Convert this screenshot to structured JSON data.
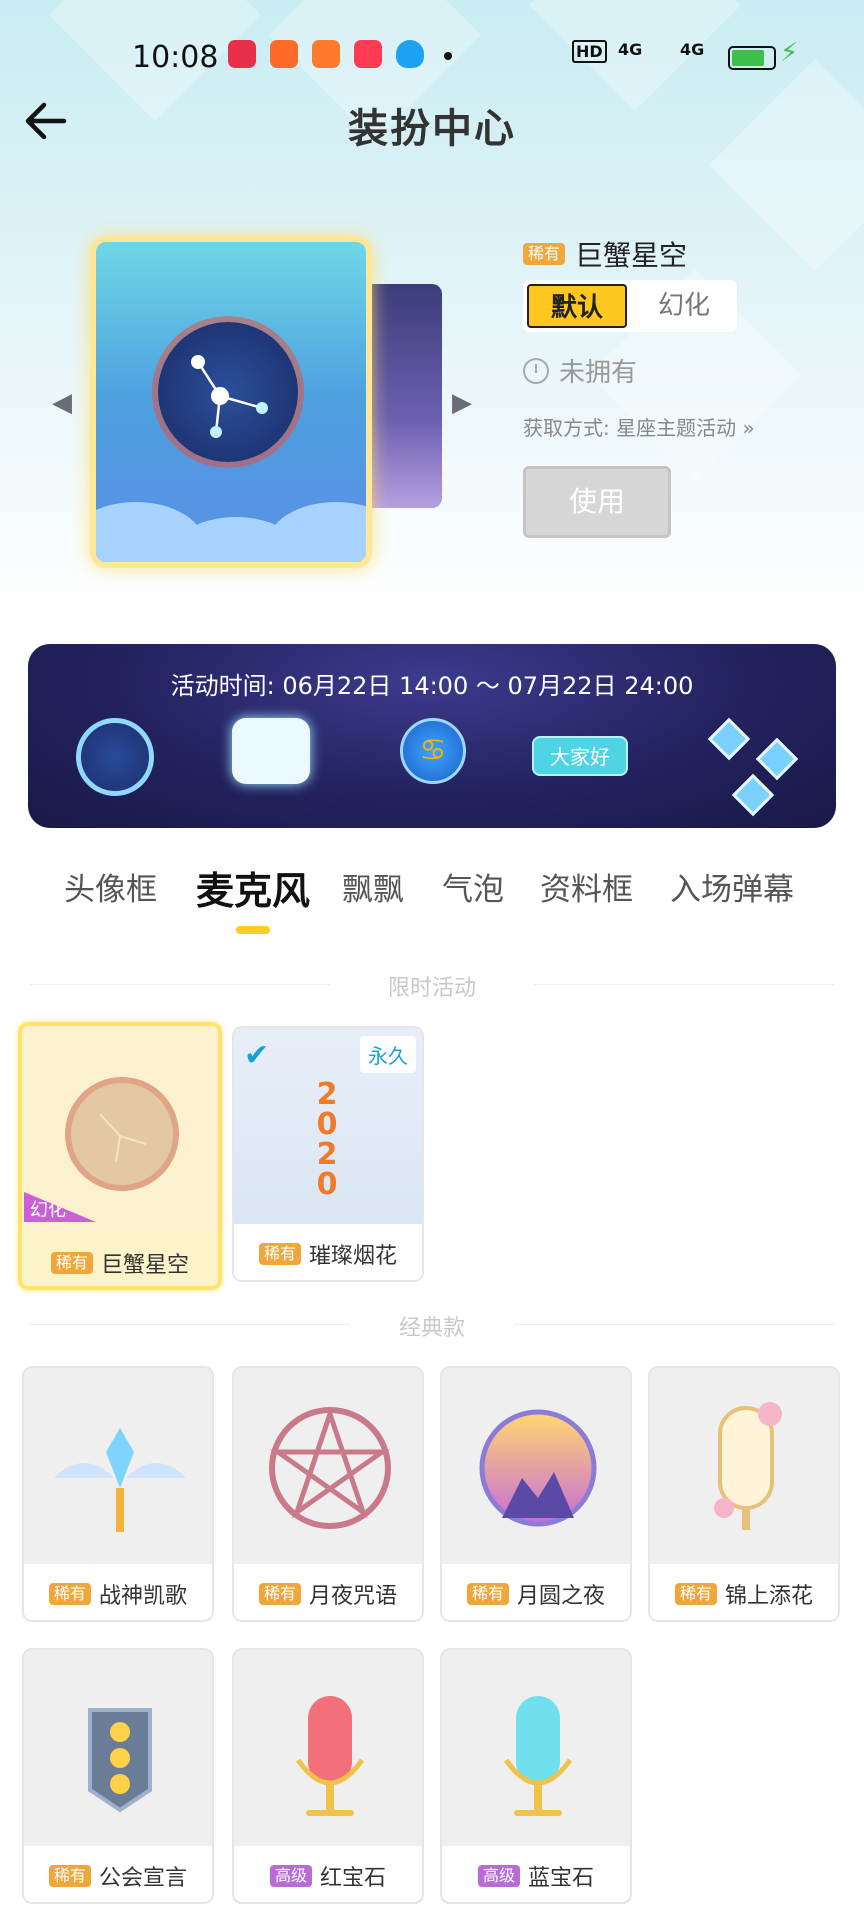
{
  "status_bar": {
    "time": "10:08",
    "signal_1": "4G",
    "signal_2": "4G",
    "hd_label": "HD"
  },
  "header": {
    "title": "装扮中心"
  },
  "preview": {
    "rarity": "稀有",
    "name": "巨蟹星空",
    "toggle": {
      "default_label": "默认",
      "illusion_label": "幻化"
    },
    "ownership": "未拥有",
    "acquire_text": "获取方式: 星座主题活动 »",
    "use_button": "使用"
  },
  "banner": {
    "time_text": "活动时间: 06月22日 14:00 ～ 07月22日 24:00",
    "bubble_text": "大家好"
  },
  "tabs": [
    {
      "label": "头像框",
      "active": false
    },
    {
      "label": "麦克风",
      "active": true
    },
    {
      "label": "飘飘",
      "active": false
    },
    {
      "label": "气泡",
      "active": false
    },
    {
      "label": "资料框",
      "active": false
    },
    {
      "label": "入场弹幕",
      "active": false
    }
  ],
  "sections": {
    "limited": {
      "title": "限时活动",
      "items": [
        {
          "rarity": "稀有",
          "name": "巨蟹星空",
          "tag": "幻化",
          "selected": true
        },
        {
          "rarity": "稀有",
          "name": "璀璨烟花",
          "tag": "永久",
          "owned": true,
          "art_text": "2020"
        }
      ]
    },
    "classic": {
      "title": "经典款",
      "items": [
        {
          "rarity": "稀有",
          "name": "战神凯歌"
        },
        {
          "rarity": "稀有",
          "name": "月夜咒语"
        },
        {
          "rarity": "稀有",
          "name": "月圆之夜"
        },
        {
          "rarity": "稀有",
          "name": "锦上添花"
        },
        {
          "rarity": "稀有",
          "name": "公会宣言"
        },
        {
          "rarity": "高级",
          "name": "红宝石"
        },
        {
          "rarity": "高级",
          "name": "蓝宝石"
        }
      ]
    }
  },
  "colors": {
    "accent_yellow": "#ffc81f",
    "rare_badge": "#f0a63a",
    "advanced_badge": "#b86bd6",
    "illusion_tag": "#c95fd9",
    "banner_bg": "#23225f"
  },
  "icons": [
    "back-arrow-icon",
    "clock-icon",
    "chevron-left-icon",
    "chevron-right-icon",
    "check-icon"
  ]
}
